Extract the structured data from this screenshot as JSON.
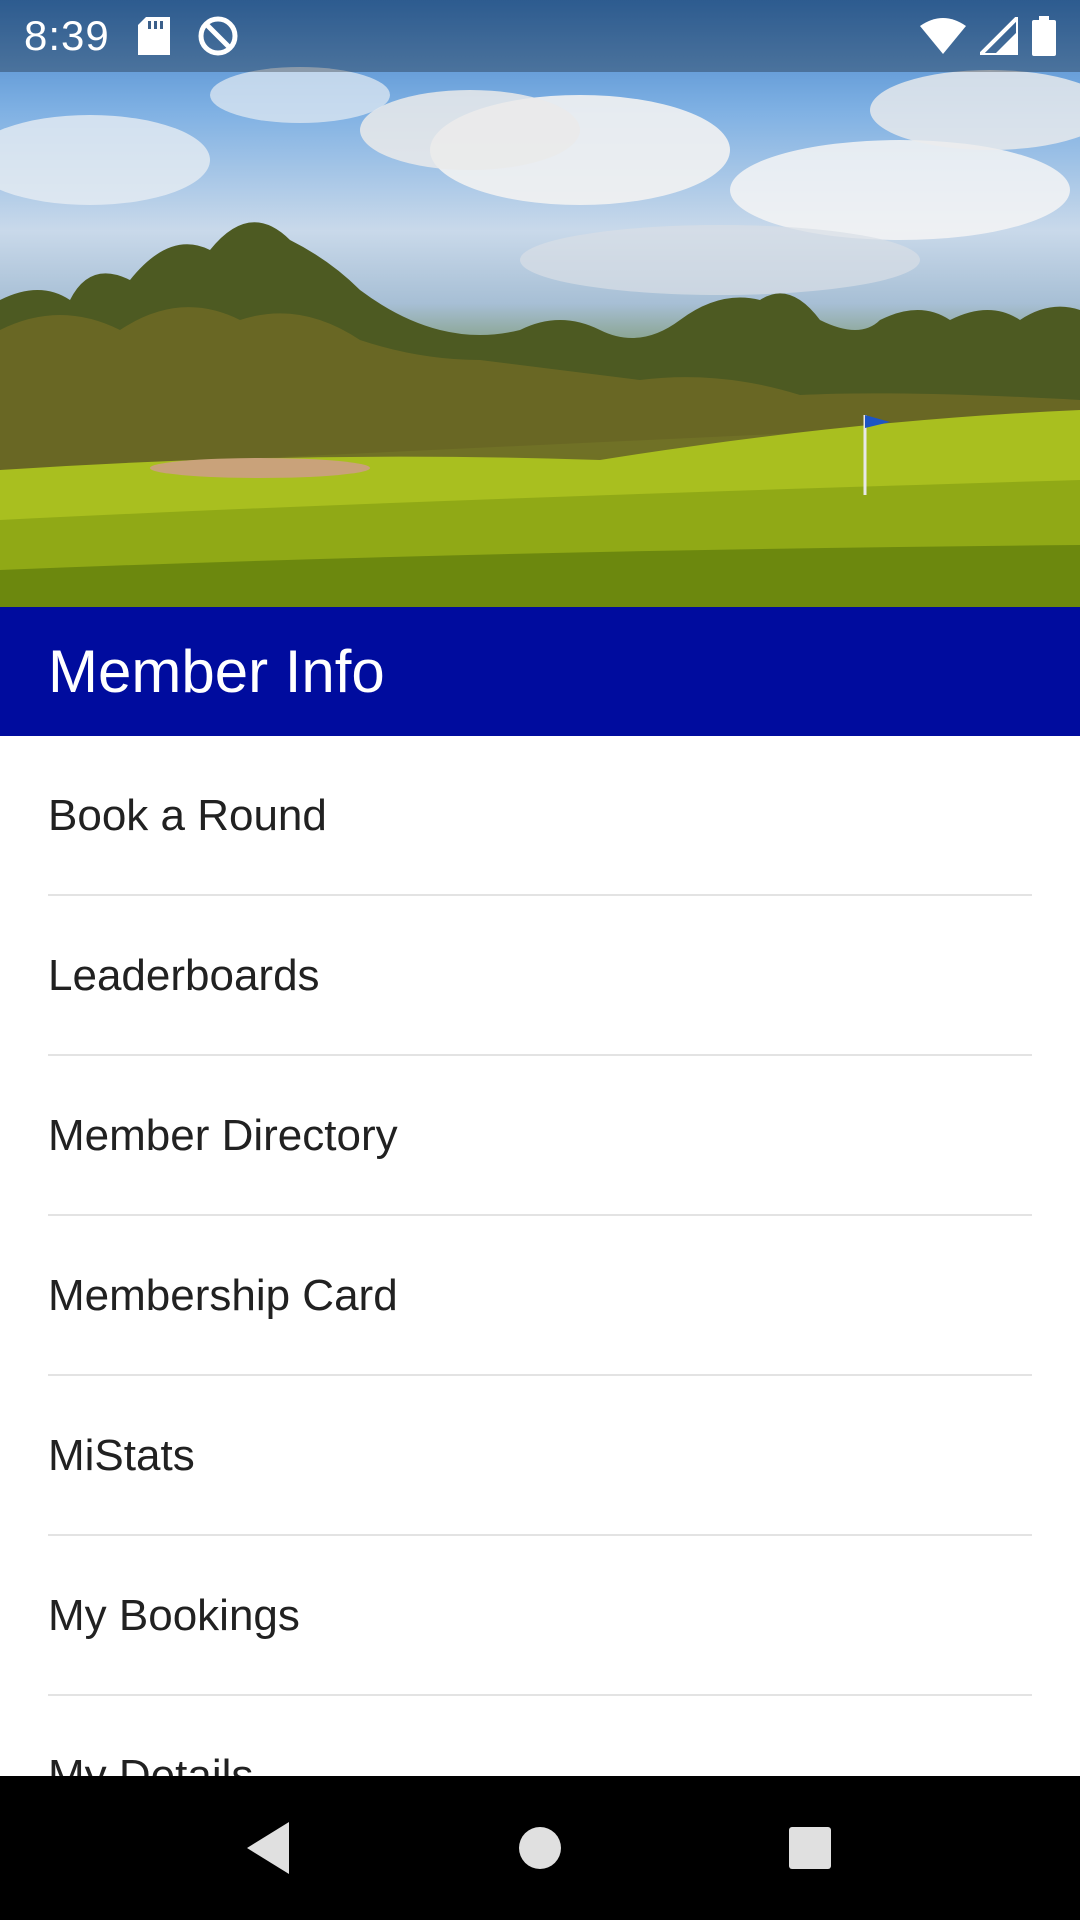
{
  "status_bar": {
    "time": "8:39",
    "icons_left": [
      "sd-card-icon",
      "data-saver-icon"
    ],
    "icons_right": [
      "wifi-icon",
      "cell-signal-icon",
      "battery-icon"
    ]
  },
  "hero": {
    "description_icon": "golf-course-banner-image"
  },
  "header": {
    "title": "Member Info",
    "color": "#000c9e"
  },
  "menu": {
    "items": [
      {
        "label": "Book a Round"
      },
      {
        "label": "Leaderboards"
      },
      {
        "label": "Member Directory"
      },
      {
        "label": "Membership Card"
      },
      {
        "label": "MiStats"
      },
      {
        "label": "My Bookings"
      },
      {
        "label": "My Details"
      }
    ]
  },
  "nav_bar": {
    "icons": [
      "back-icon",
      "home-icon",
      "recents-icon"
    ]
  }
}
